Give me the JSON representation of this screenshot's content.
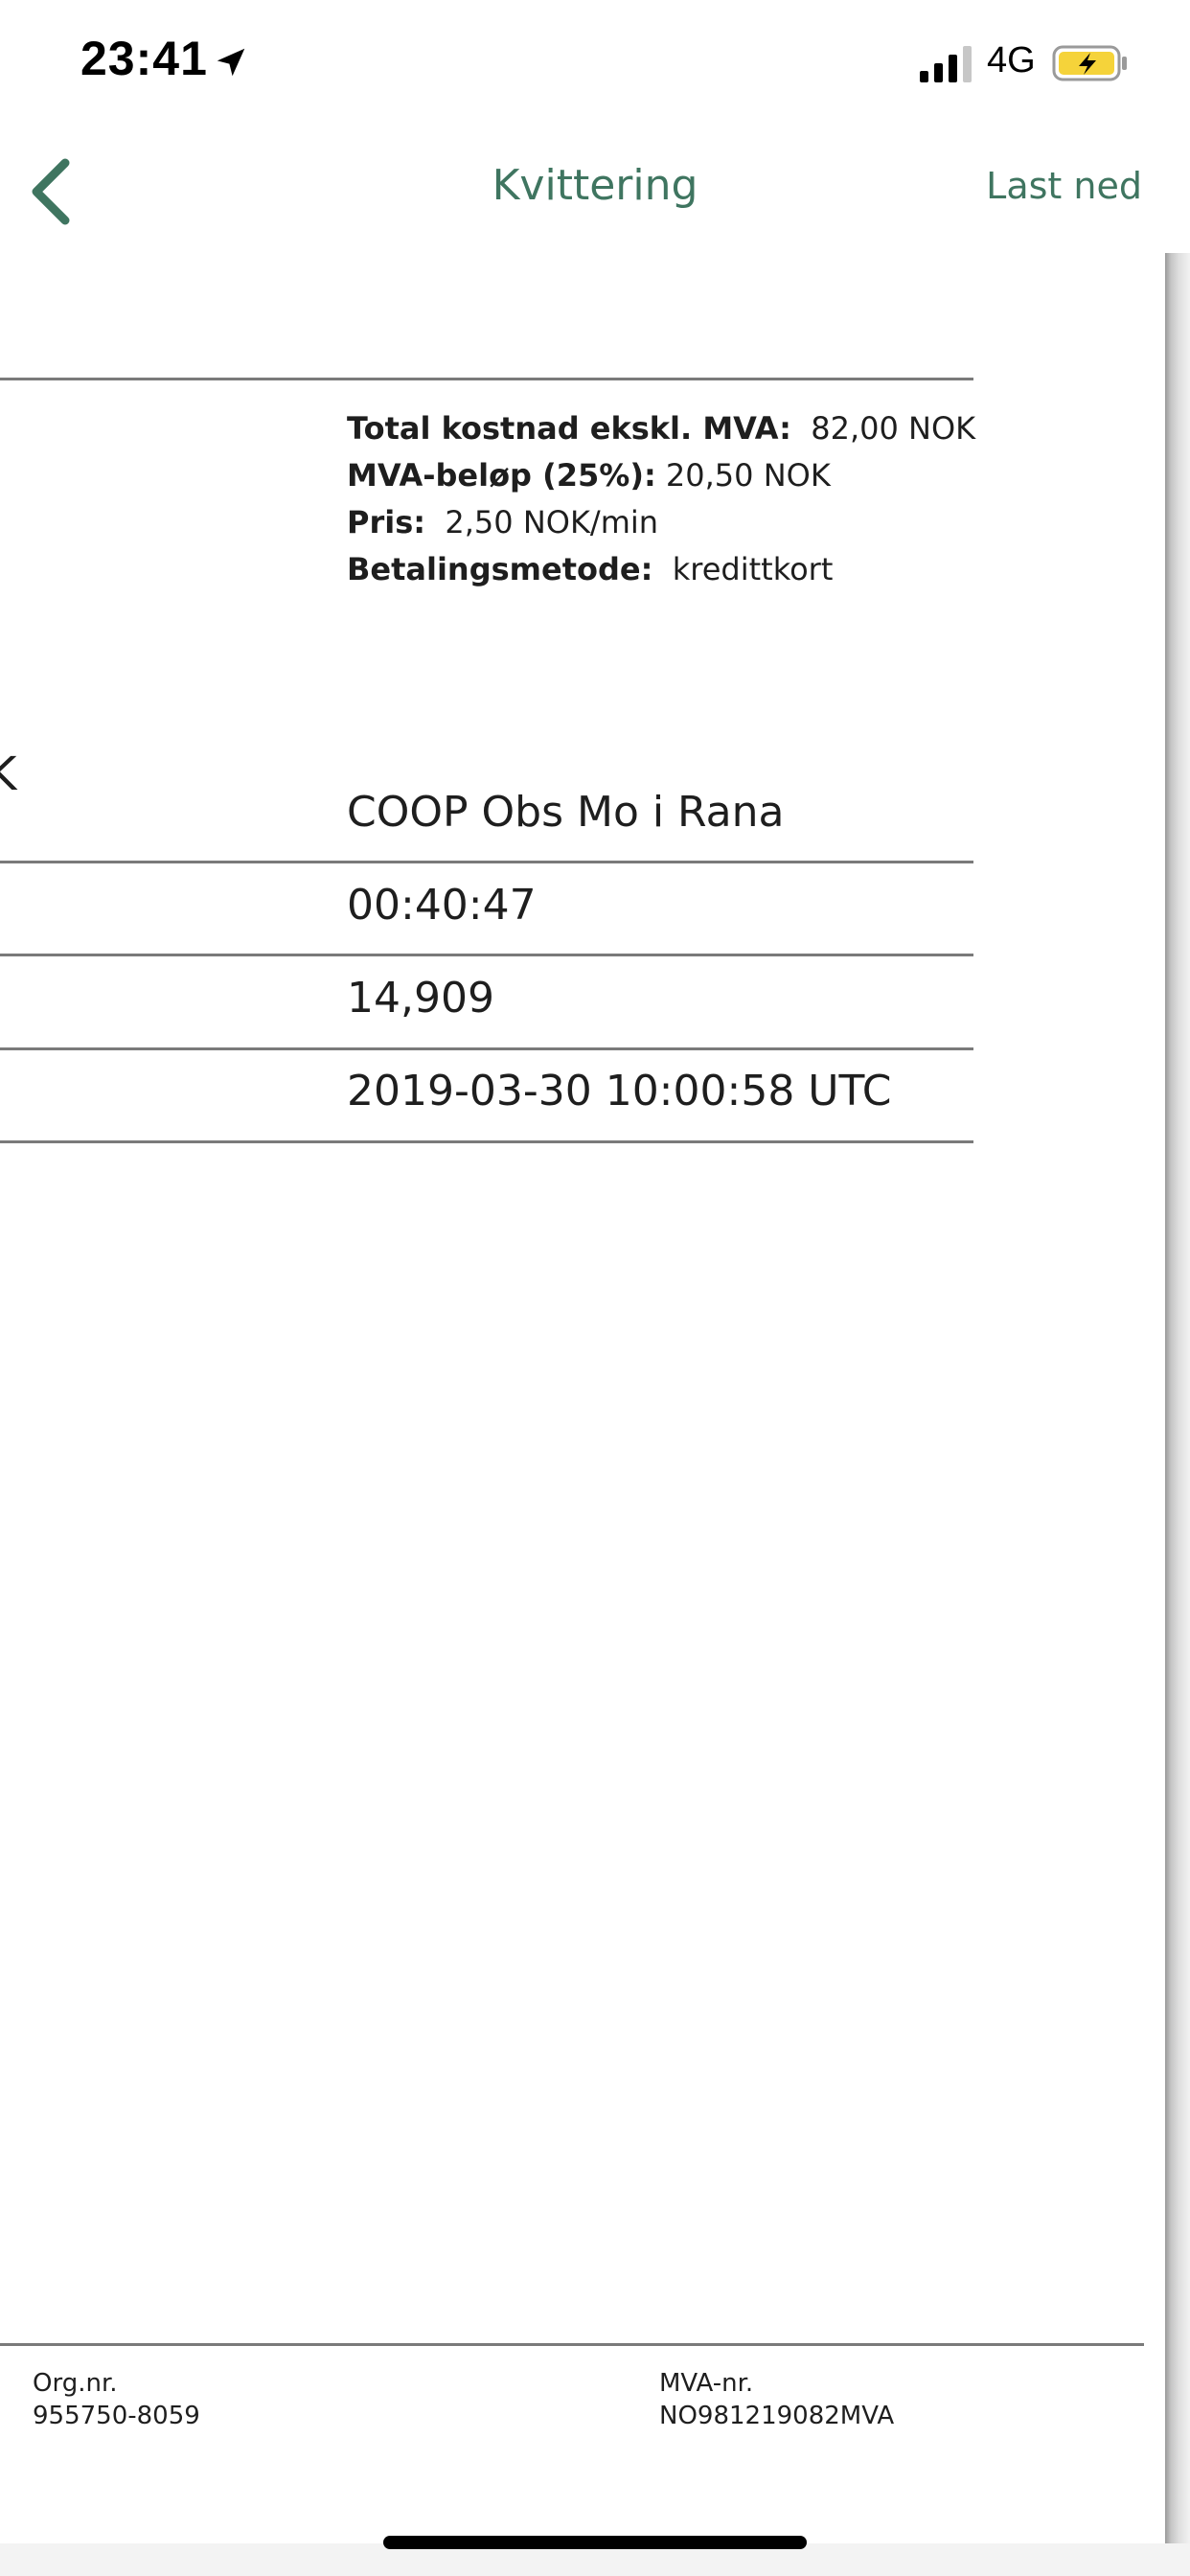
{
  "status_bar": {
    "time": "23:41",
    "network": "4G",
    "icons": [
      "location-arrow-icon",
      "signal-icon",
      "battery-charging-icon"
    ],
    "battery_color": "#f5d33a"
  },
  "nav": {
    "title": "Kvittering",
    "download_label": "Last ned",
    "accent_color": "#3f7560"
  },
  "summary": {
    "total_excl_label": "Total kostnad ekskl. MVA:",
    "total_excl_value": "82,00 NOK",
    "vat_label": "MVA-beløp (25%):",
    "vat_value": "20,50 NOK",
    "price_label": "Pris:",
    "price_value": "2,50 NOK/min",
    "payment_label": "Betalingsmetode:",
    "payment_value": "kredittkort",
    "cut_off_char": "K"
  },
  "details": {
    "rows": [
      {
        "value": "COOP Obs Mo i Rana"
      },
      {
        "value": "00:40:47"
      },
      {
        "value": "14,909"
      },
      {
        "value": "2019-03-30 10:00:58 UTC"
      }
    ]
  },
  "footer": {
    "org_label": "Org.nr.",
    "org_value": "955750-8059",
    "vat_label": "MVA-nr.",
    "vat_value": "NO981219082MVA"
  }
}
